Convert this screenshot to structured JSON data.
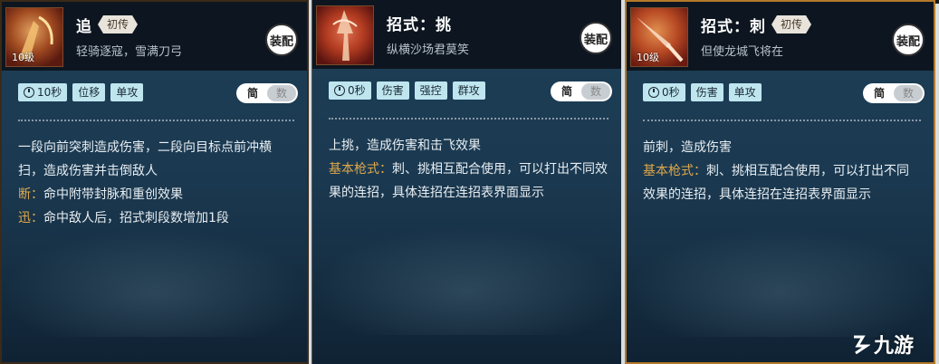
{
  "cards": [
    {
      "title": "追",
      "rank": "初传",
      "subtitle": "轻骑逐寇，雪满刀弓",
      "level": "10级",
      "equip": "装配",
      "cooldown": "10秒",
      "tags": [
        "位移",
        "单攻"
      ],
      "toggle": [
        "简",
        "数"
      ],
      "desc_lines": [
        {
          "label": "",
          "text": "一段向前突刺造成伤害，二段向目标点前冲横扫，造成伤害并击倒敌人"
        },
        {
          "label": "断：",
          "text": "命中附带封脉和重创效果"
        },
        {
          "label": "迅：",
          "text": "命中敌人后，招式刺段数增加1段"
        }
      ]
    },
    {
      "title": "招式：挑",
      "rank": "",
      "subtitle": "纵横沙场君莫笑",
      "level": "",
      "equip": "装配",
      "cooldown": "0秒",
      "tags": [
        "伤害",
        "强控",
        "群攻"
      ],
      "toggle": [
        "简",
        "数"
      ],
      "desc_lines": [
        {
          "label": "",
          "text": "上挑，造成伤害和击飞效果"
        },
        {
          "label": "基本枪式：",
          "text": "刺、挑相互配合使用，可以打出不同效果的连招，具体连招在连招表界面显示"
        }
      ]
    },
    {
      "title": "招式：刺",
      "rank": "初传",
      "subtitle": "但使龙城飞将在",
      "level": "10级",
      "equip": "装配",
      "cooldown": "0秒",
      "tags": [
        "伤害",
        "单攻"
      ],
      "toggle": [
        "简",
        "数"
      ],
      "desc_lines": [
        {
          "label": "",
          "text": "前刺，造成伤害"
        },
        {
          "label": "基本枪式：",
          "text": "刺、挑相互配合使用，可以打出不同效果的连招，具体连招在连招表界面显示"
        }
      ]
    }
  ],
  "watermark": "九游",
  "colors": {
    "accent": "#e0a84a",
    "tag_bg": "#bfe6ef",
    "panel_bg": "#1b3a52"
  }
}
